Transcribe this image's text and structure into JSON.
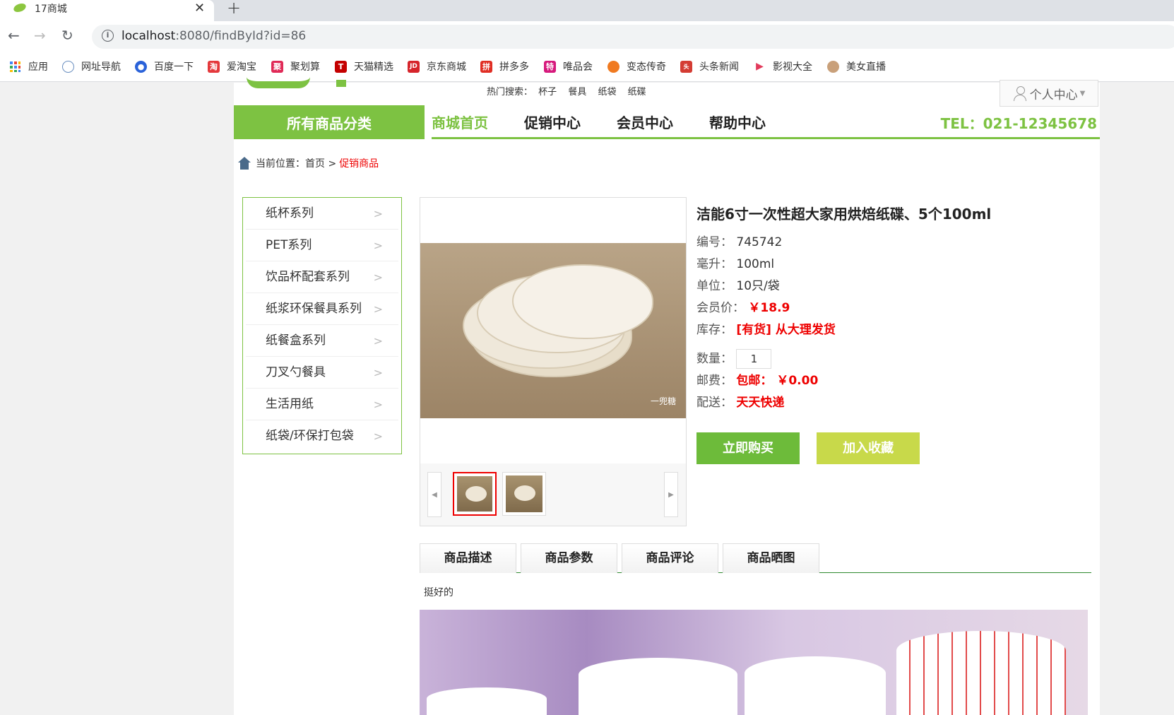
{
  "browser": {
    "tab_title": "17商城",
    "new_tab": "+",
    "close": "✕",
    "url_host": "localhost",
    "url_rest": ":8080/findById?id=86"
  },
  "bookmarks": [
    {
      "label": "应用",
      "icon": "apps-grid-icon",
      "color": "#4285f4"
    },
    {
      "label": "网址导航",
      "icon": "globe-icon",
      "color": "#6a8fc0"
    },
    {
      "label": "百度一下",
      "icon": "baidu-paw-icon",
      "color": "#2a62d9"
    },
    {
      "label": "爱淘宝",
      "icon": "taobao-icon",
      "color": "#e4393c"
    },
    {
      "label": "聚划算",
      "icon": "juhuasuan-icon",
      "color": "#e02a57"
    },
    {
      "label": "天猫精选",
      "icon": "tmall-icon",
      "color": "#c40000"
    },
    {
      "label": "京东商城",
      "icon": "jd-icon",
      "color": "#d6242b"
    },
    {
      "label": "拼多多",
      "icon": "pinduoduo-icon",
      "color": "#e02e24"
    },
    {
      "label": "唯品会",
      "icon": "vip-icon",
      "color": "#d6197c"
    },
    {
      "label": "变态传奇",
      "icon": "game-icon",
      "color": "#f07a20"
    },
    {
      "label": "头条新闻",
      "icon": "toutiao-icon",
      "color": "#d43c33"
    },
    {
      "label": "影视大全",
      "icon": "play-icon",
      "color": "#e23a5b"
    },
    {
      "label": "美女直播",
      "icon": "avatar-icon",
      "color": "#c9a07a"
    }
  ],
  "header": {
    "hot_label": "热门搜索：",
    "hot_terms": [
      "杯子",
      "餐具",
      "纸袋",
      "纸碟"
    ],
    "user_center": "个人中心"
  },
  "nav": {
    "all_categories": "所有商品分类",
    "items": [
      "商城首页",
      "促销中心",
      "会员中心",
      "帮助中心"
    ],
    "tel": "TEL：021-12345678"
  },
  "breadcrumb": {
    "prefix": "当前位置：首页 >",
    "current": "促销商品"
  },
  "sidebar": [
    "纸杯系列",
    "PET系列",
    "饮品杯配套系列",
    "纸浆环保餐具系列",
    "纸餐盒系列",
    "刀叉勺餐具",
    "生活用纸",
    "纸袋/环保打包袋"
  ],
  "gallery": {
    "watermark": "一兜糖"
  },
  "product": {
    "title": "洁能6寸一次性超大家用烘焙纸碟、5个100ml",
    "code_label": "编号：",
    "code": "745742",
    "ml_label": "毫升：",
    "ml": "100ml",
    "unit_label": "单位：",
    "unit": "10只/袋",
    "price_label": "会员价：",
    "price": "￥18.9",
    "stock_label": "库存：",
    "stock": "[有货] 从大理发货",
    "qty_label": "数量：",
    "qty": "1",
    "post_label": "邮费：",
    "post": "包邮： ￥0.00",
    "ship_label": "配送：",
    "ship": "天天快递",
    "buy": "立即购买",
    "favorite": "加入收藏"
  },
  "tabs": [
    "商品描述",
    "商品参数",
    "商品评论",
    "商品晒图"
  ],
  "description": "挺好的"
}
